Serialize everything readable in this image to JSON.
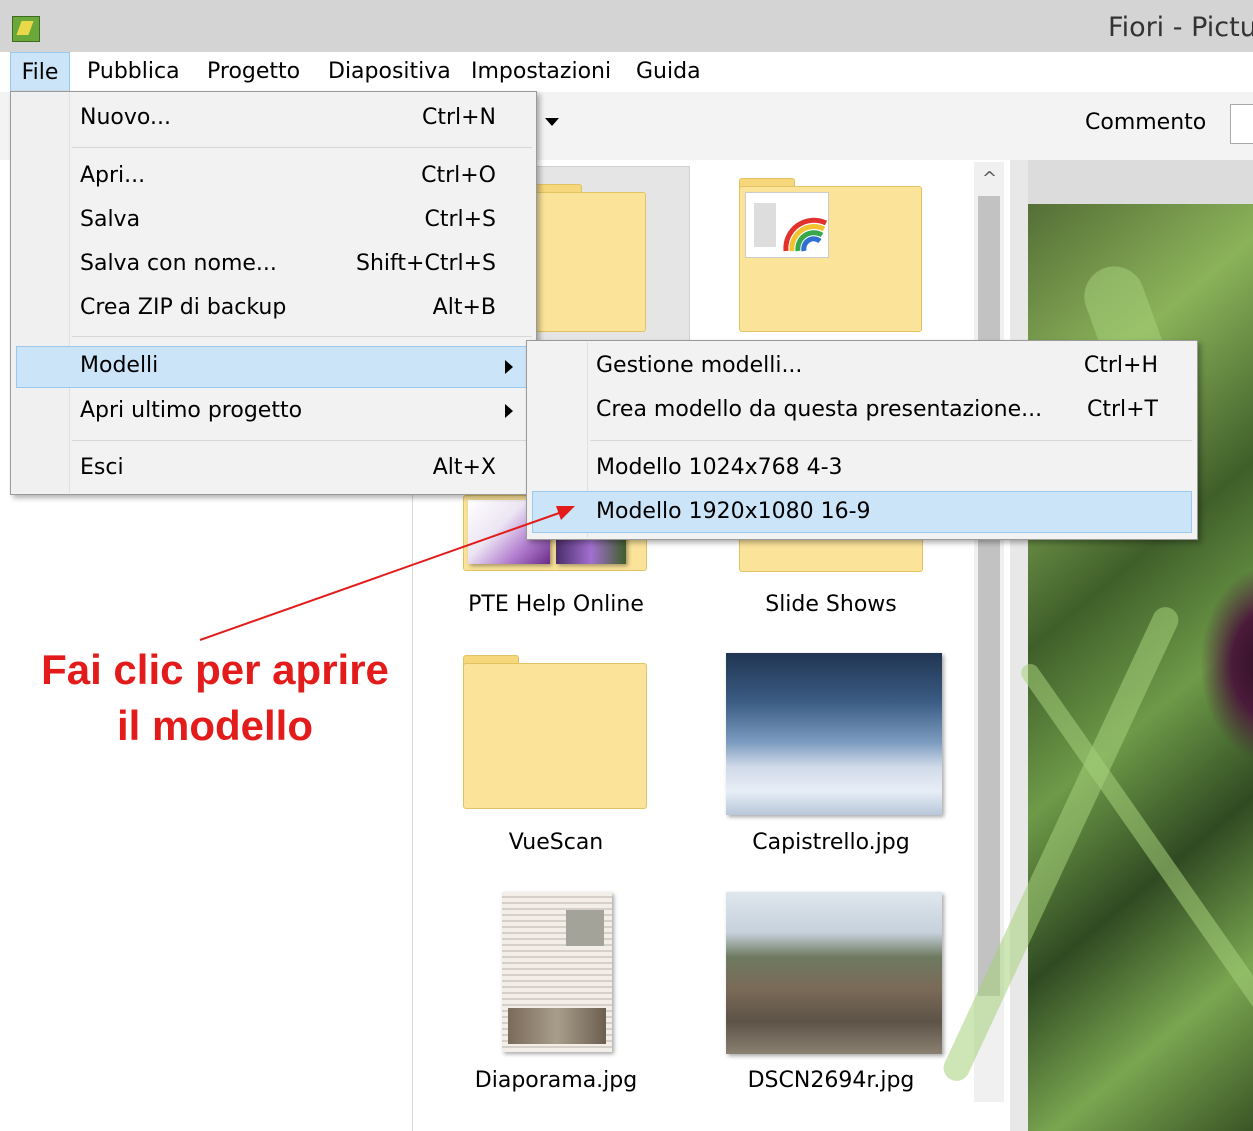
{
  "window": {
    "title": "Fiori - Pictu"
  },
  "menubar": {
    "items": [
      "File",
      "Pubblica",
      "Progetto",
      "Diapositiva",
      "Impostazioni",
      "Guida"
    ]
  },
  "toolbar": {
    "comment_label": "Commento"
  },
  "file_menu": {
    "items": [
      {
        "label": "Nuovo...",
        "shortcut": "Ctrl+N"
      },
      {
        "label": "Apri...",
        "shortcut": "Ctrl+O"
      },
      {
        "label": "Salva",
        "shortcut": "Ctrl+S"
      },
      {
        "label": "Salva con nome...",
        "shortcut": "Shift+Ctrl+S"
      },
      {
        "label": "Crea ZIP di backup",
        "shortcut": "Alt+B"
      },
      {
        "label": "Modelli",
        "shortcut": ""
      },
      {
        "label": "Apri ultimo progetto",
        "shortcut": ""
      },
      {
        "label": "Esci",
        "shortcut": "Alt+X"
      }
    ]
  },
  "templates_submenu": {
    "items": [
      {
        "label": "Gestione modelli...",
        "shortcut": "Ctrl+H"
      },
      {
        "label": "Crea modello da questa presentazione...",
        "shortcut": "Ctrl+T"
      },
      {
        "label": "Modello 1024x768 4-3",
        "shortcut": ""
      },
      {
        "label": "Modello 1920x1080 16-9",
        "shortcut": ""
      }
    ]
  },
  "file_browser": {
    "tiles": [
      "PTE Help Online",
      "Slide Shows",
      "VueScan",
      "Capistrello.jpg",
      "Diaporama.jpg",
      "DSCN2694r.jpg"
    ]
  },
  "annotation": {
    "line1": "Fai clic per aprire",
    "line2": "il modello",
    "color": "#e31b1b"
  },
  "colors": {
    "highlight": "#cce4f7",
    "folder": "#fbe39a"
  }
}
